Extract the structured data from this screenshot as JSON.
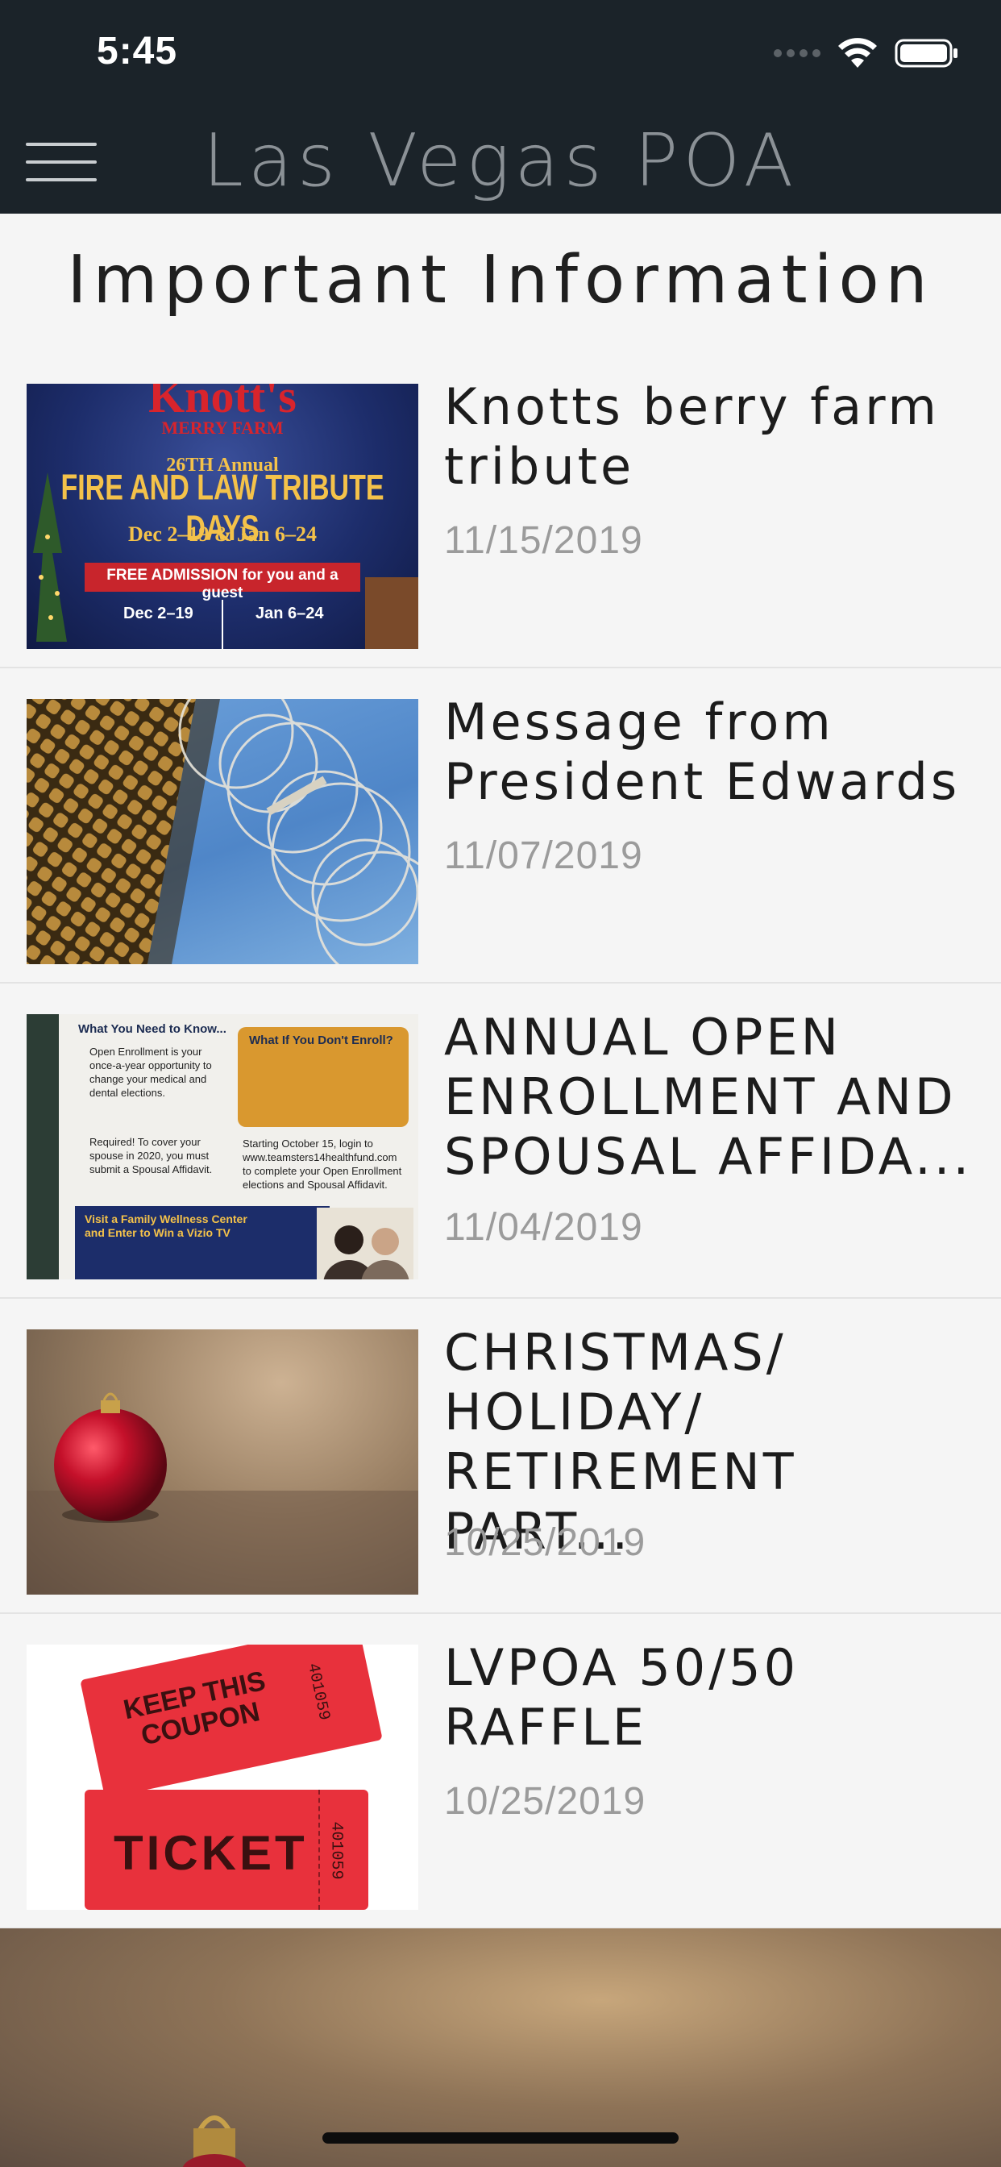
{
  "status_bar": {
    "time": "5:45"
  },
  "nav": {
    "title": "Las Vegas POA"
  },
  "page": {
    "title": "Important Information"
  },
  "items": [
    {
      "title": "Knotts berry farm tribute",
      "date": "11/15/2019",
      "image": {
        "brand": "Knott's",
        "brand_sub": "MERRY FARM",
        "annual": "26TH Annual",
        "headline": "FIRE AND LAW TRIBUTE DAYS",
        "dates": "Dec 2–19 & Jan 6–24",
        "admission": "FREE ADMISSION for you and a guest",
        "col1": "Dec 2–19",
        "col2": "Jan 6–24"
      }
    },
    {
      "title": "Message from President Edwards",
      "date": "11/07/2019"
    },
    {
      "title": "ANNUAL OPEN ENROLLMENT AND SPOUSAL AFFIDA...",
      "date": "11/04/2019",
      "image": {
        "heading": "What You Need to Know...",
        "callout_title": "What If You Don't Enroll?",
        "bullet1": "Open Enrollment is your once-a-year opportunity to change your medical and dental elections.",
        "bullet2": "Required! To cover your spouse in 2020, you must submit a Spousal Affidavit.",
        "bullet3": "Starting October 15, login to www.teamsters14healthfund.com to complete your Open Enrollment elections and Spousal Affidavit.",
        "banner": "Visit a Family Wellness Center and Enter to Win a Vizio TV"
      }
    },
    {
      "title": "CHRISTMAS/ HOLIDAY/ RETIREMENT PART...",
      "date": "10/25/2019"
    },
    {
      "title": "LVPOA 50/50 RAFFLE",
      "date": "10/25/2019",
      "image": {
        "ticket1": "KEEP THIS COUPON",
        "ticket2": "TICKET",
        "serial": "401059"
      }
    }
  ]
}
